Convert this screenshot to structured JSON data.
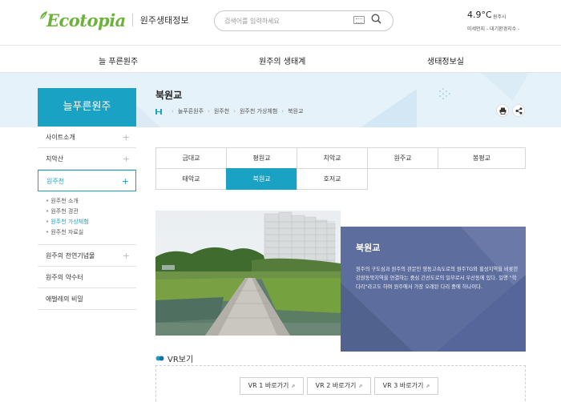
{
  "header": {
    "logo_text": "Ecotopia",
    "site_name": "원주생태정보",
    "search_placeholder": "검색어를 입력하세요",
    "weather": {
      "temp": "4.9°C",
      "location": "원주시",
      "info": "미세먼지 -   대기환경지수 -"
    }
  },
  "gnb": {
    "items": [
      {
        "label": "늘 푸른원주"
      },
      {
        "label": "원주의 생태계"
      },
      {
        "label": "생태정보실"
      }
    ]
  },
  "sidebar": {
    "title": "늘푸른원주",
    "items": [
      {
        "label": "사이트소개"
      },
      {
        "label": "치악산"
      },
      {
        "label": "원주천"
      },
      {
        "label": "원주의 천연기념물"
      },
      {
        "label": "원주의 약수터"
      },
      {
        "label": "애벌레의 비밀"
      }
    ],
    "sub_items": [
      {
        "label": "원주천 소개"
      },
      {
        "label": "원주천 경관"
      },
      {
        "label": "원주천 가상체험"
      },
      {
        "label": "원주천 자료실"
      }
    ]
  },
  "content": {
    "page_title": "북원교",
    "breadcrumb": [
      "늘푸른원주",
      "원주천",
      "원주천 가상체험",
      "북원교"
    ]
  },
  "tabs": [
    {
      "label": "금대교"
    },
    {
      "label": "평원교"
    },
    {
      "label": "치악교"
    },
    {
      "label": "원주교"
    },
    {
      "label": "봉평교"
    },
    {
      "label": "태악교"
    },
    {
      "label": "북원교"
    },
    {
      "label": "호저교"
    }
  ],
  "active_tab": "북원교",
  "info_box": {
    "title": "북원교",
    "description": "원주의 구도심과 원주의 관문인 영동고속도로의 원주TG와 횡성지역을 비롯한 강원동북지역을 연결하는 중심 간선도로의 일부로서 우산동에 있다. 일명 \"학다리\"라고도 하며 원주에서 가장 오래된 다리 중에 하나이다."
  },
  "vr": {
    "title": "VR보기",
    "buttons": [
      {
        "label": "VR 1 바로가기"
      },
      {
        "label": "VR 2 바로가기"
      },
      {
        "label": "VR 3 바로가기"
      }
    ]
  },
  "colors": {
    "accent": "#1aa2c4",
    "info_bg": "#5d6d9d",
    "band_bg": "#e6f2f9",
    "logo_green": "#6bb33a"
  },
  "icons": {
    "search": "search-icon",
    "keyboard": "keyboard-icon",
    "home": "home-icon",
    "print": "print-icon",
    "share": "share-icon",
    "vr": "vr-icon",
    "link": "external-link-icon"
  }
}
